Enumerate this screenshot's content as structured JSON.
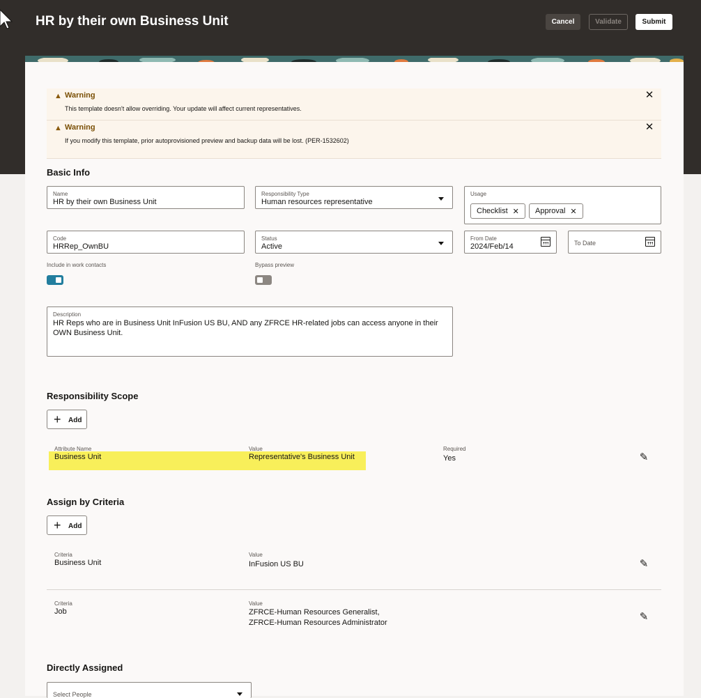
{
  "header": {
    "title": "HR by their own Business Unit",
    "cancel": "Cancel",
    "validate": "Validate",
    "submit": "Submit"
  },
  "warnings": [
    {
      "title": "Warning",
      "message": "This template doesn't allow overriding. Your update will affect current representatives."
    },
    {
      "title": "Warning",
      "message": "If you modify this template, prior autoprovisioned preview and backup data will be lost. (PER-1532602)"
    }
  ],
  "basic_info": {
    "title": "Basic Info",
    "name": {
      "label": "Name",
      "value": "HR by their own Business Unit"
    },
    "responsibility_type": {
      "label": "Responsibility Type",
      "value": "Human resources representative"
    },
    "usage": {
      "label": "Usage",
      "chips": [
        "Checklist",
        "Approval"
      ]
    },
    "code": {
      "label": "Code",
      "value": "HRRep_OwnBU"
    },
    "status": {
      "label": "Status",
      "value": "Active"
    },
    "from_date": {
      "label": "From Date",
      "value": "2024/Feb/14"
    },
    "to_date": {
      "label": "To Date",
      "value": ""
    },
    "include_work_contacts": {
      "label": "Include in work contacts",
      "on": true
    },
    "bypass_preview": {
      "label": "Bypass preview",
      "on": false
    },
    "description": {
      "label": "Description",
      "value": "HR Reps who are in Business Unit InFusion US BU, AND any ZFRCE HR-related jobs can access anyone in their OWN Business Unit."
    }
  },
  "responsibility_scope": {
    "title": "Responsibility Scope",
    "add_label": "Add",
    "row": {
      "attribute_label": "Attribute Name",
      "attribute_value": "Business Unit",
      "value_label": "Value",
      "value": "Representative's Business Unit",
      "required_label": "Required",
      "required": "Yes"
    }
  },
  "assign_by_criteria": {
    "title": "Assign by Criteria",
    "add_label": "Add",
    "rows": [
      {
        "criteria_label": "Criteria",
        "criteria": "Business Unit",
        "value_label": "Value",
        "value_lines": [
          "InFusion US BU"
        ]
      },
      {
        "criteria_label": "Criteria",
        "criteria": "Job",
        "value_label": "Value",
        "value_lines": [
          "ZFRCE-Human Resources Generalist,",
          "ZFRCE-Human Resources Administrator"
        ]
      }
    ]
  },
  "directly_assigned": {
    "title": "Directly Assigned",
    "select_placeholder": "Select People"
  },
  "colors": {
    "header_bg": "#312d2a",
    "toggle_on": "#227e9e",
    "highlight": "#f8ef5a",
    "warning_bg": "#fcf5ec"
  }
}
